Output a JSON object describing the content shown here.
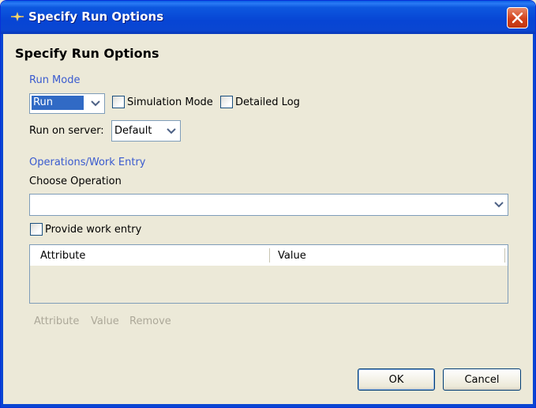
{
  "window": {
    "title": "Specify Run Options"
  },
  "page": {
    "heading": "Specify Run Options"
  },
  "run_mode": {
    "section_label": "Run Mode",
    "mode_value": "Run",
    "simulation_mode_label": "Simulation Mode",
    "simulation_mode_checked": false,
    "detailed_log_label": "Detailed Log",
    "detailed_log_checked": false,
    "server_label": "Run on server:",
    "server_value": "Default"
  },
  "operations": {
    "section_label": "Operations/Work Entry",
    "choose_label": "Choose Operation",
    "operation_value": "",
    "provide_work_entry_label": "Provide work entry",
    "provide_work_entry_checked": false,
    "columns": [
      "Attribute",
      "Value"
    ],
    "actions": {
      "attribute": "Attribute",
      "value": "Value",
      "remove": "Remove"
    }
  },
  "footer": {
    "ok_label": "OK",
    "cancel_label": "Cancel"
  },
  "colors": {
    "section_text": "#3a5bcf",
    "titlebar": "#0a46d2",
    "dialog_bg": "#ece9d8",
    "disabled_text": "#aca899"
  },
  "icons": {
    "title": "app-spark-icon",
    "close": "close-x-icon",
    "dropdown": "chevron-down-icon"
  }
}
